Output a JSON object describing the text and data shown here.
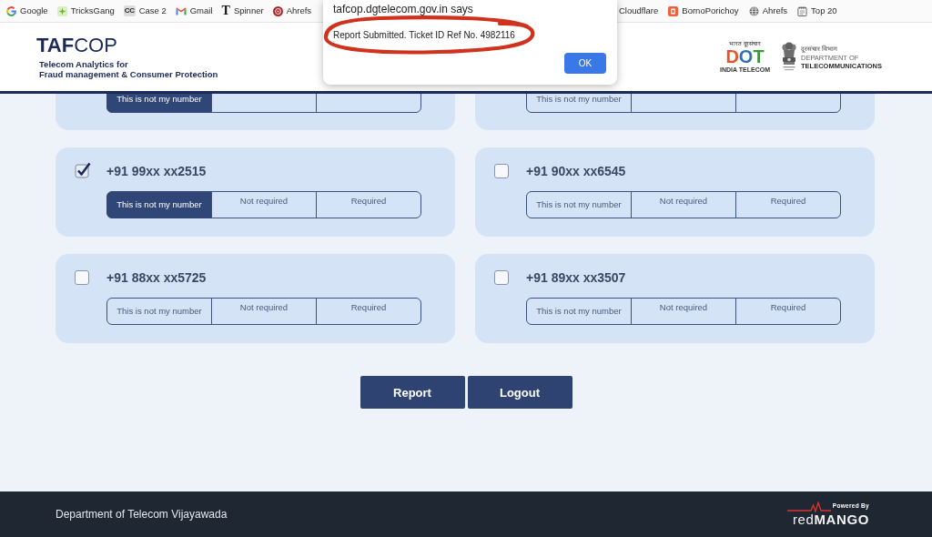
{
  "bookmarks_bar": {
    "left": [
      {
        "label": "Google"
      },
      {
        "label": "TricksGang"
      },
      {
        "label": "Case 2",
        "glyph": "CC"
      },
      {
        "label": "Gmail"
      },
      {
        "label": "Spinner",
        "glyph": "T"
      },
      {
        "label": "Ahrefs"
      }
    ],
    "right": [
      {
        "label": "Cloudflare"
      },
      {
        "label": "BornoPorichoy"
      },
      {
        "label": "Ahrefs"
      },
      {
        "label": "Top 20"
      }
    ]
  },
  "dialog": {
    "title": "tafcop.dgtelecom.gov.in says",
    "message": "Report Submitted. Ticket ID Ref No. 4982116",
    "button": "OK"
  },
  "header": {
    "logo": "**TAF**COP",
    "tagline": "Telecom Analytics for\nFraud management & Consumer Protection",
    "dot_logo": {
      "top_text": "भारत दूरसंचार",
      "mark": "DOT",
      "bottom_text": "INDIA TELECOM"
    },
    "department": {
      "hindi": "दूरसंचार विभाग",
      "name": "DEPARTMENT OF\n**TELECOMMUNICATIONS**"
    }
  },
  "cards": [
    {
      "kind": "partial",
      "options": [
        {
          "label": "This is not my number",
          "selected": true
        },
        {
          "selected": false
        },
        {
          "selected": false
        }
      ]
    },
    {
      "kind": "partial",
      "options": [
        {
          "label": "This is not my number",
          "selected": false
        },
        {
          "selected": false
        },
        {
          "selected": false
        }
      ]
    },
    {
      "kind": "full",
      "checked": true,
      "number": "+91 99xx xx2515",
      "options": [
        {
          "label": "This is not my number",
          "selected": true
        },
        {
          "label": "Not required",
          "selected": false
        },
        {
          "label": "Required",
          "selected": false
        }
      ]
    },
    {
      "kind": "full",
      "checked": false,
      "number": "+91 90xx xx6545",
      "options": [
        {
          "label": "This is not my number",
          "selected": false
        },
        {
          "label": "Not required",
          "selected": false
        },
        {
          "label": "Required",
          "selected": false
        }
      ]
    },
    {
      "kind": "full",
      "checked": false,
      "number": "+91 88xx xx5725",
      "options": [
        {
          "label": "This is not my number",
          "selected": false
        },
        {
          "label": "Not required",
          "selected": false
        },
        {
          "label": "Required",
          "selected": false
        }
      ]
    },
    {
      "kind": "full",
      "checked": false,
      "number": "+91 89xx xx3507",
      "options": [
        {
          "label": "This is not my number",
          "selected": false
        },
        {
          "label": "Not required",
          "selected": false
        },
        {
          "label": "Required",
          "selected": false
        }
      ]
    }
  ],
  "actions": [
    "Report",
    "Logout"
  ],
  "footer": {
    "text": "Department of Telecom Vijayawada",
    "powered_by": "Powered By",
    "brand": "red**MANGO**"
  }
}
